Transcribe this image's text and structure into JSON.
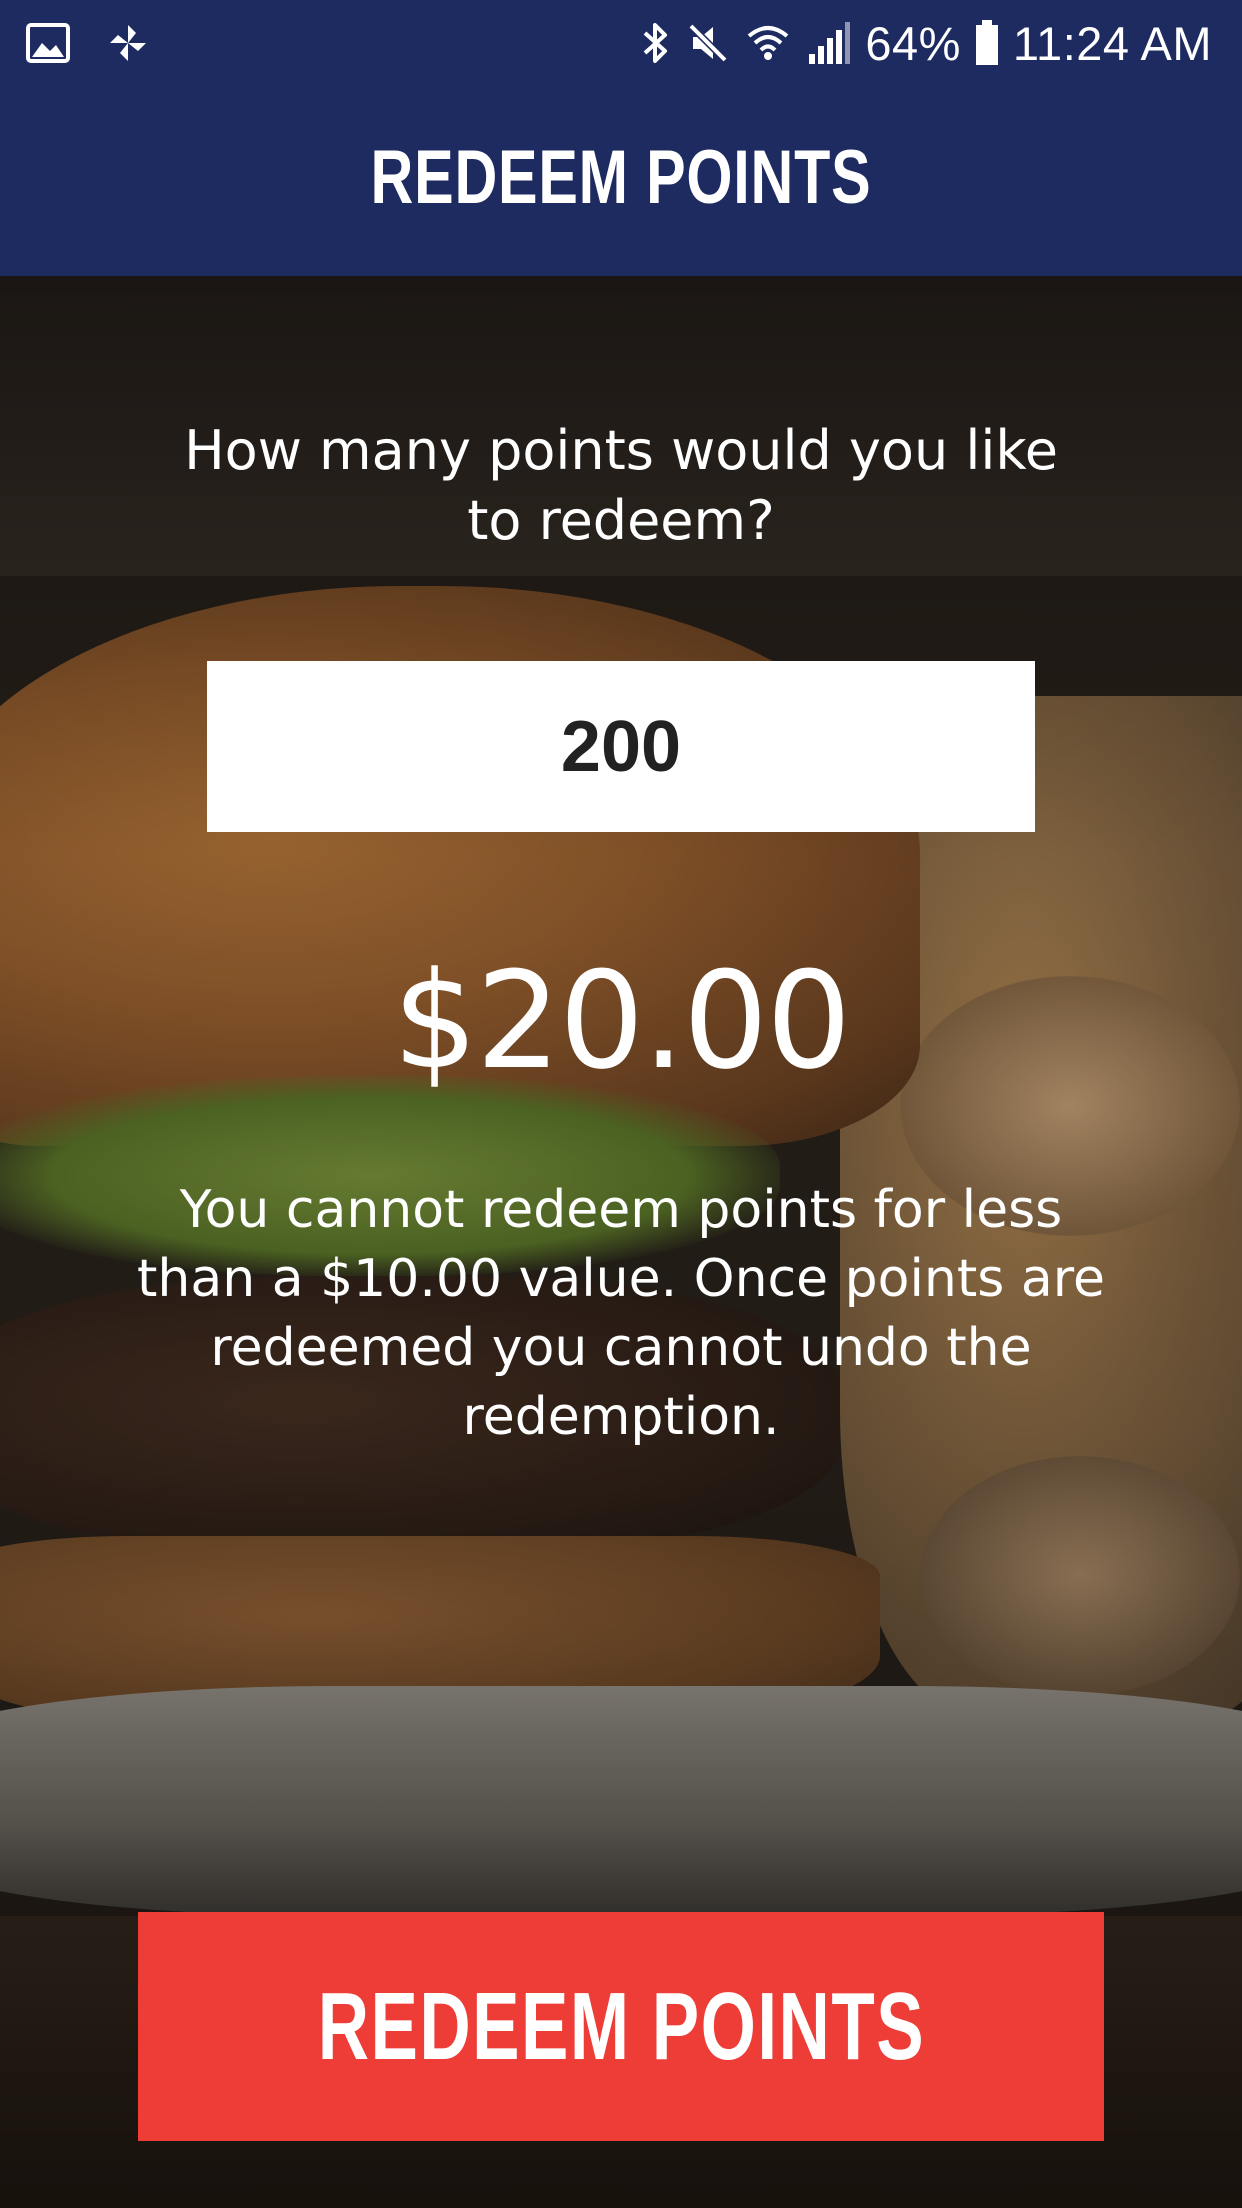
{
  "status_bar": {
    "battery": "64%",
    "time": "11:24 AM",
    "left_icons": [
      "gallery-icon",
      "pinwheel-icon"
    ],
    "right_icons": [
      "bluetooth-icon",
      "mute-icon",
      "wifi-icon",
      "signal-icon",
      "battery-icon"
    ]
  },
  "header": {
    "title": "REDEEM POINTS",
    "background_color": "#1d2b60"
  },
  "main": {
    "question": "How many points would you like to redeem?",
    "points_value": "200",
    "amount": "$20.00",
    "disclaimer": "You cannot redeem points for less than a $10.00 value. Once points are redeemed you cannot undo the redemption."
  },
  "action": {
    "redeem_label": "REDEEM POINTS",
    "button_color": "#ee3c37"
  }
}
